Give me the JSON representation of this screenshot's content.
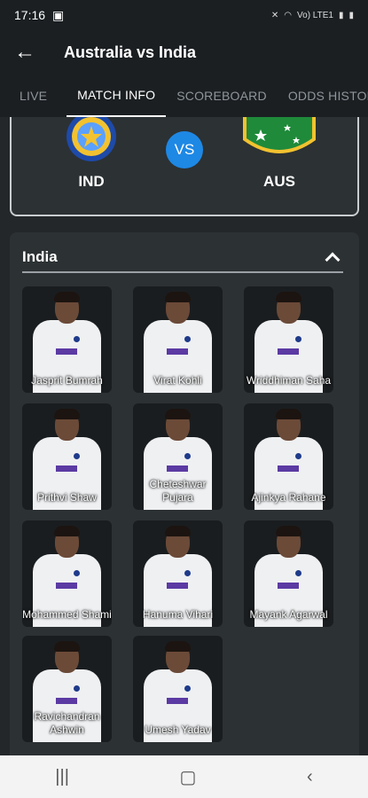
{
  "status_bar": {
    "time": "17:16",
    "network": "Vo) LTE1"
  },
  "app_bar": {
    "title": "Australia vs India"
  },
  "tabs": [
    {
      "label": "LIVE"
    },
    {
      "label": "MATCH INFO"
    },
    {
      "label": "SCOREBOARD"
    },
    {
      "label": "ODDS HISTORY"
    }
  ],
  "match": {
    "team1": "IND",
    "team2": "AUS",
    "vs": "VS"
  },
  "squad": {
    "title": "India",
    "players": [
      "Jasprit Bumrah",
      "Virat Kohli",
      "Wriddhiman Saha",
      "Prithvi Shaw",
      "Cheteshwar Pujara",
      "Ajinkya Rahane",
      "Mohammed Shami",
      "Hanuma Vihari",
      "Mayank Agarwal",
      "Ravichandran Ashwin",
      "Umesh Yadav"
    ]
  },
  "colors": {
    "vs_badge": "#1e88e5",
    "ind_blue": "#1e4aa8",
    "aus_green": "#1f8a3a",
    "aus_gold": "#f2c230"
  }
}
